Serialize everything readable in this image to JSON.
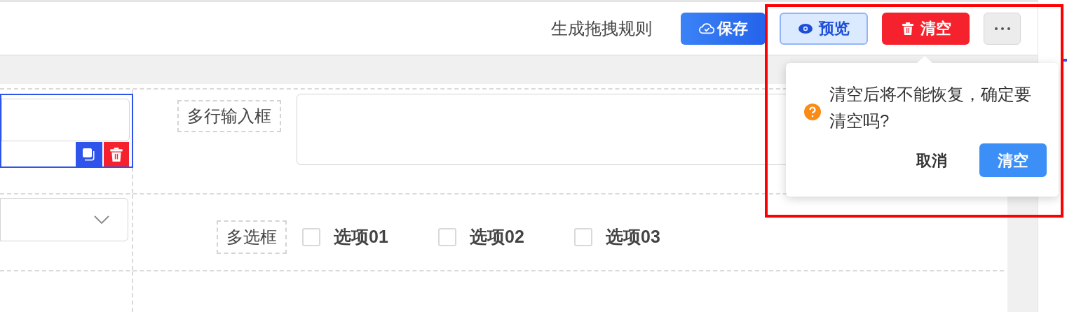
{
  "toolbar": {
    "generate_rules": "生成拖拽规则",
    "buttons": [
      {
        "kind": "save",
        "label": "保存"
      },
      {
        "kind": "preview",
        "label": "预览"
      },
      {
        "kind": "clear",
        "label": "清空"
      },
      {
        "kind": "more"
      }
    ]
  },
  "form": {
    "rows": [
      {
        "left": {
          "kind": "input",
          "selected": true
        },
        "right": {
          "kind": "textarea",
          "label": "多行输入框",
          "selected": false
        }
      },
      {
        "left": {
          "kind": "select",
          "selected": false
        },
        "right": {
          "kind": "checkbox",
          "label": "多选框",
          "selected": false,
          "options": [
            {
              "label": "选项01",
              "checked": false
            },
            {
              "label": "选项02",
              "checked": false
            },
            {
              "label": "选项03",
              "checked": false
            }
          ]
        }
      }
    ]
  },
  "popconfirm": {
    "message": "清空后将不能恢复，确定要清空吗?",
    "cancel": "取消",
    "confirm": "清空"
  },
  "highlight": true
}
